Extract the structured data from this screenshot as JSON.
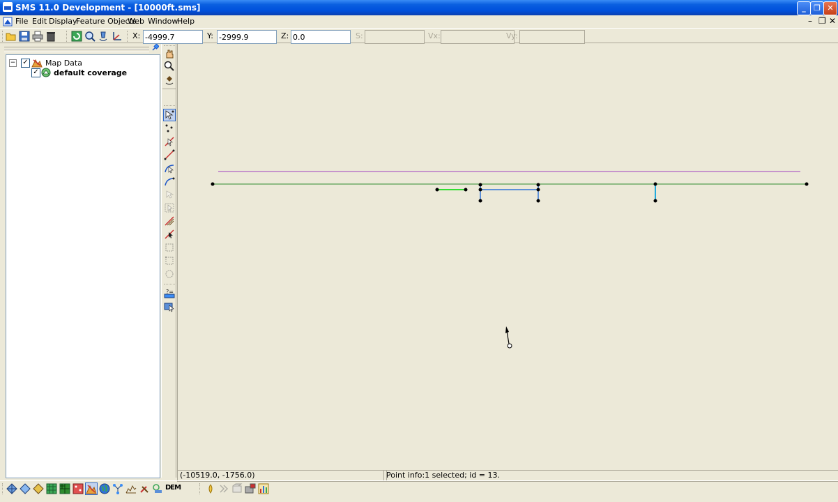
{
  "window": {
    "title": "SMS 11.0 Development - [10000ft.sms]"
  },
  "menu": {
    "items": [
      "File",
      "Edit",
      "Display",
      "Feature Objects",
      "Web",
      "Window",
      "Help"
    ]
  },
  "toolbar": {
    "x_label": "X:",
    "x_value": "-4999.7",
    "y_label": "Y:",
    "y_value": "-2999.9",
    "z_label": "Z:",
    "z_value": "0.0",
    "s_label": "S:",
    "vx_label": "Vx:",
    "vy_label": "Vy:"
  },
  "tree": {
    "root_label": "Map Data",
    "child_label": "default coverage"
  },
  "status": {
    "coords": "(-10519.0, -1756.0)",
    "info": "Point info:1 selected; id = 13."
  },
  "bottom_toolbar": {
    "dem_label": "DEM"
  },
  "colors": {
    "title_bar": "#0a5fe0",
    "arc_main": "#2e8b2e",
    "arc_purple": "#a040c0",
    "arc_selected": "#33dd33",
    "arc_blue": "#2f73d8",
    "arc_cyan": "#22aadd"
  }
}
